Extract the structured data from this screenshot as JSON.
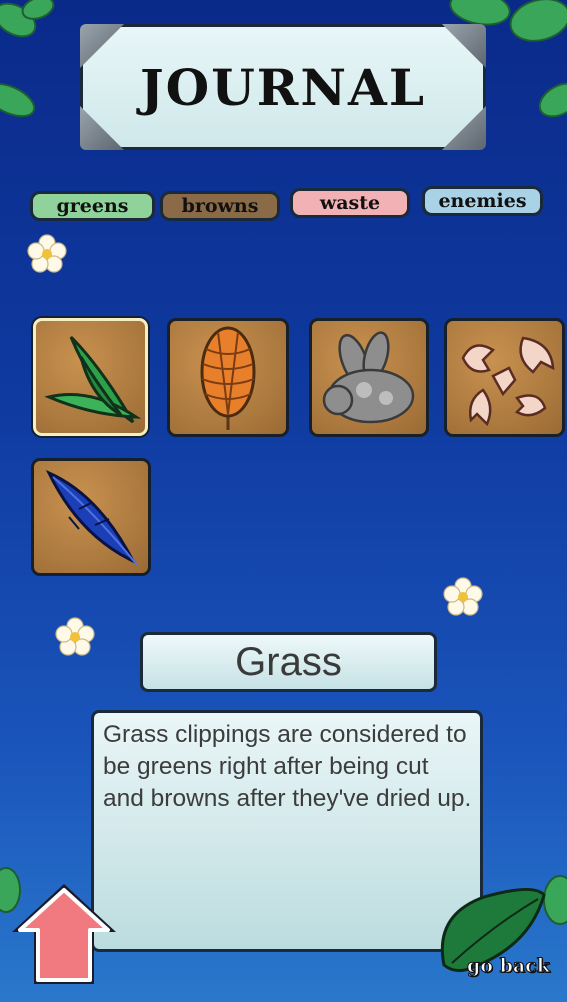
{
  "title": "JOURNAL",
  "tabs": [
    {
      "label": "greens"
    },
    {
      "label": "browns"
    },
    {
      "label": "waste"
    },
    {
      "label": "enemies"
    }
  ],
  "items": [
    {
      "icon": "grass-icon",
      "selected": true
    },
    {
      "icon": "pinecone-icon",
      "selected": false
    },
    {
      "icon": "dust-bunny-icon",
      "selected": false
    },
    {
      "icon": "eggshells-icon",
      "selected": false
    },
    {
      "icon": "feather-icon",
      "selected": false
    }
  ],
  "selected_item": {
    "name": "Grass",
    "description": "Grass clippings are considered to be greens right after being cut and browns after they've dried up."
  },
  "buttons": {
    "home_icon": "up-arrow-icon",
    "back_label": "go back"
  },
  "colors": {
    "greens": "#8fd39a",
    "browns": "#8b6a48",
    "waste": "#f2b1b5",
    "enemies": "#aad2e6",
    "home": "#f07a80"
  }
}
